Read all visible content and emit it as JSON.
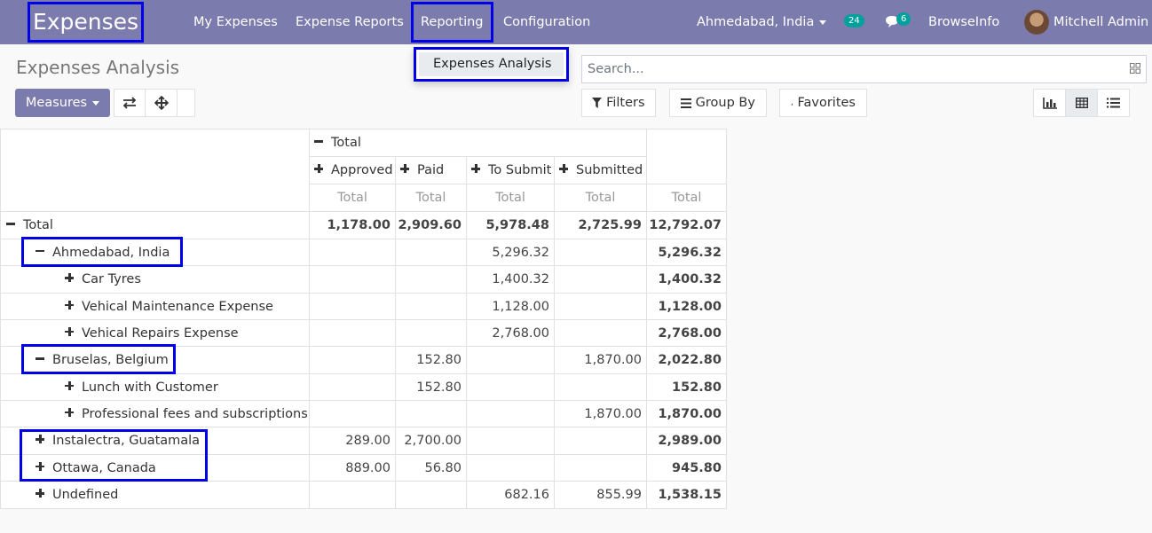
{
  "navbar": {
    "brand": "Expenses",
    "menu": [
      "My Expenses",
      "Expense Reports",
      "Reporting",
      "Configuration"
    ],
    "company": "Ahmedabad, India",
    "activity_count": "24",
    "message_count": "6",
    "website": "BrowseInfo",
    "user": "Mitchell Admin"
  },
  "dropdown": {
    "item": "Expenses Analysis"
  },
  "control": {
    "title": "Expenses Analysis",
    "search_placeholder": "Search...",
    "measures": "Measures",
    "filters": "Filters",
    "group_by": "Group By",
    "favorites": "Favorites"
  },
  "pivot": {
    "col_total": "Total",
    "columns": [
      "Approved",
      "Paid",
      "To Submit",
      "Submitted"
    ],
    "measure": "Total",
    "rows": [
      {
        "label": "Total",
        "values": [
          "1,178.00",
          "2,909.60",
          "5,978.48",
          "2,725.99",
          "12,792.07"
        ]
      },
      {
        "label": "Ahmedabad, India",
        "values": [
          "",
          "",
          "5,296.32",
          "",
          "5,296.32"
        ]
      },
      {
        "label": "Car Tyres",
        "values": [
          "",
          "",
          "1,400.32",
          "",
          "1,400.32"
        ]
      },
      {
        "label": "Vehical Maintenance Expense",
        "values": [
          "",
          "",
          "1,128.00",
          "",
          "1,128.00"
        ]
      },
      {
        "label": "Vehical Repairs Expense",
        "values": [
          "",
          "",
          "2,768.00",
          "",
          "2,768.00"
        ]
      },
      {
        "label": "Bruselas, Belgium",
        "values": [
          "",
          "152.80",
          "",
          "1,870.00",
          "2,022.80"
        ]
      },
      {
        "label": "Lunch with Customer",
        "values": [
          "",
          "152.80",
          "",
          "",
          "152.80"
        ]
      },
      {
        "label": "Professional fees and subscriptions",
        "values": [
          "",
          "",
          "",
          "1,870.00",
          "1,870.00"
        ]
      },
      {
        "label": "Instalectra, Guatamala",
        "values": [
          "289.00",
          "2,700.00",
          "",
          "",
          "2,989.00"
        ]
      },
      {
        "label": "Ottawa, Canada",
        "values": [
          "889.00",
          "56.80",
          "",
          "",
          "945.80"
        ]
      },
      {
        "label": "Undefined",
        "values": [
          "",
          "",
          "682.16",
          "855.99",
          "1,538.15"
        ]
      }
    ]
  }
}
